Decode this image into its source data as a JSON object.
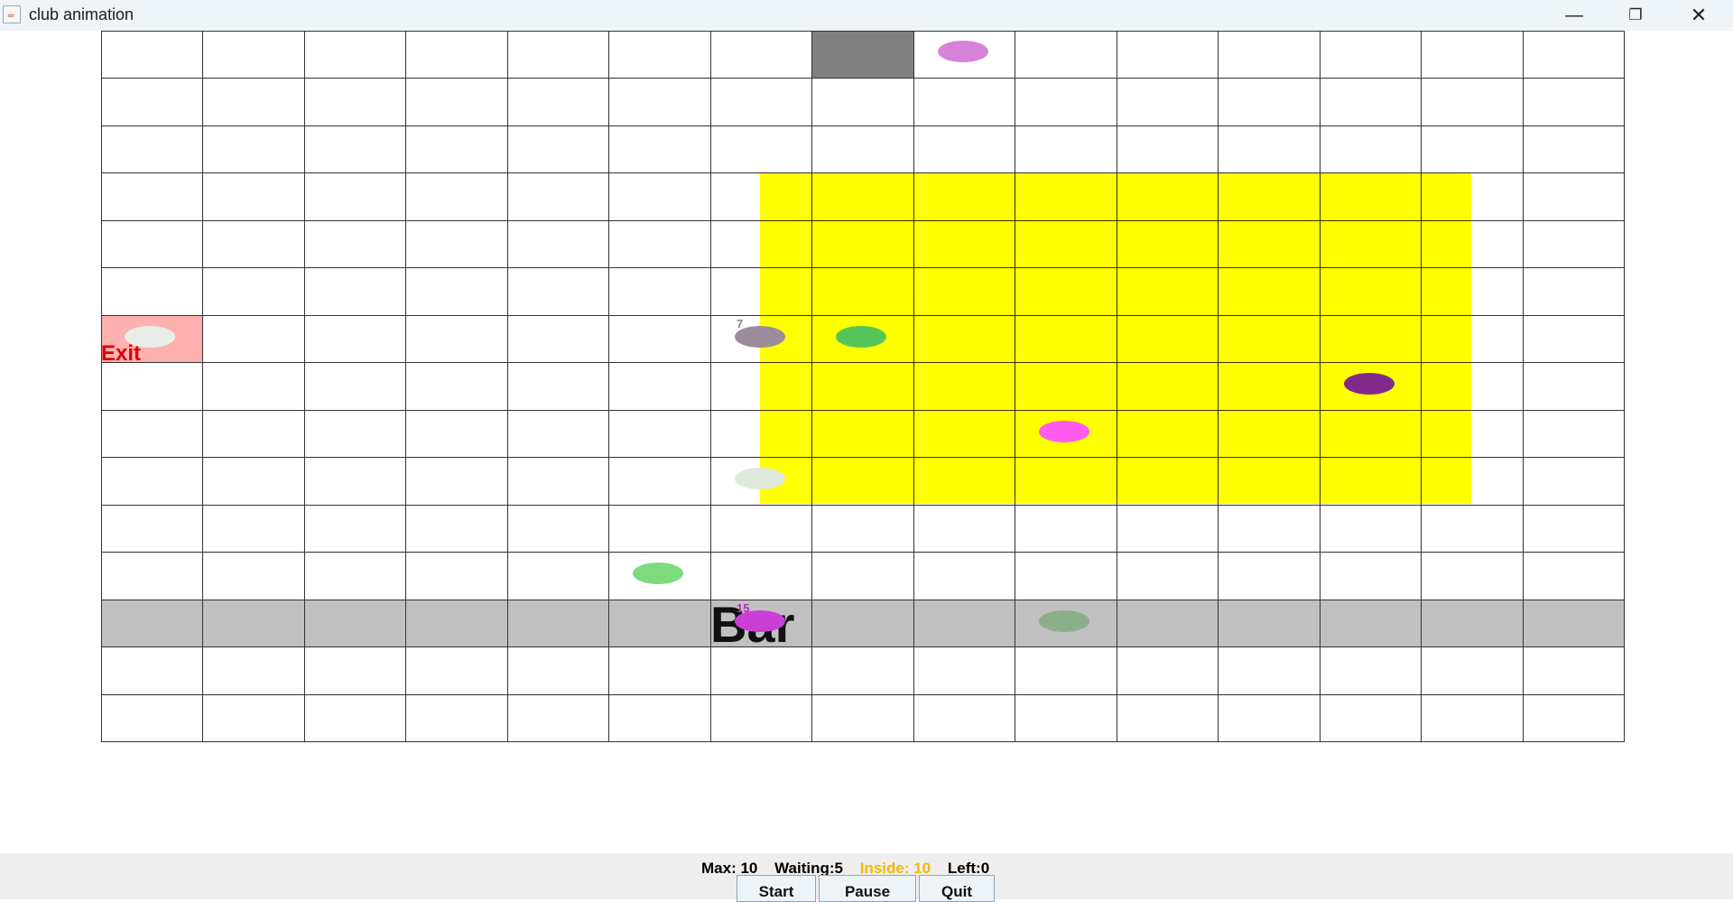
{
  "window": {
    "title": "club animation",
    "controls": {
      "minimize": "—",
      "maximize": "❐",
      "close": "✕"
    },
    "icon": "java-app-icon"
  },
  "club": {
    "exit_label": "Exit",
    "bar_label": "Bar",
    "colors": {
      "dance_floor": "#ffff00",
      "bar_row": "#c0c0c0",
      "entrance": "#808080",
      "exit": "#ffb0b0",
      "exit_text": "#e00000"
    },
    "patrons": [
      {
        "color": "#d783d7"
      },
      {
        "color": "#e9ede7"
      },
      {
        "color": "#9b8e9a",
        "tag": "7"
      },
      {
        "color": "#55c55a"
      },
      {
        "color": "#822a8c"
      },
      {
        "color": "#ff5bf0"
      },
      {
        "color": "#dfeadc"
      },
      {
        "color": "#7ddb7e"
      },
      {
        "color": "#c93fd5",
        "tag": "15"
      },
      {
        "color": "#8cae8a"
      }
    ]
  },
  "status": {
    "max": "Max: 10",
    "waiting": "Waiting:5",
    "inside": "Inside: 10",
    "left": "Left:0",
    "inside_color": "#f5b800"
  },
  "controls": {
    "start": "Start",
    "pause": "Pause",
    "quit": "Quit"
  }
}
